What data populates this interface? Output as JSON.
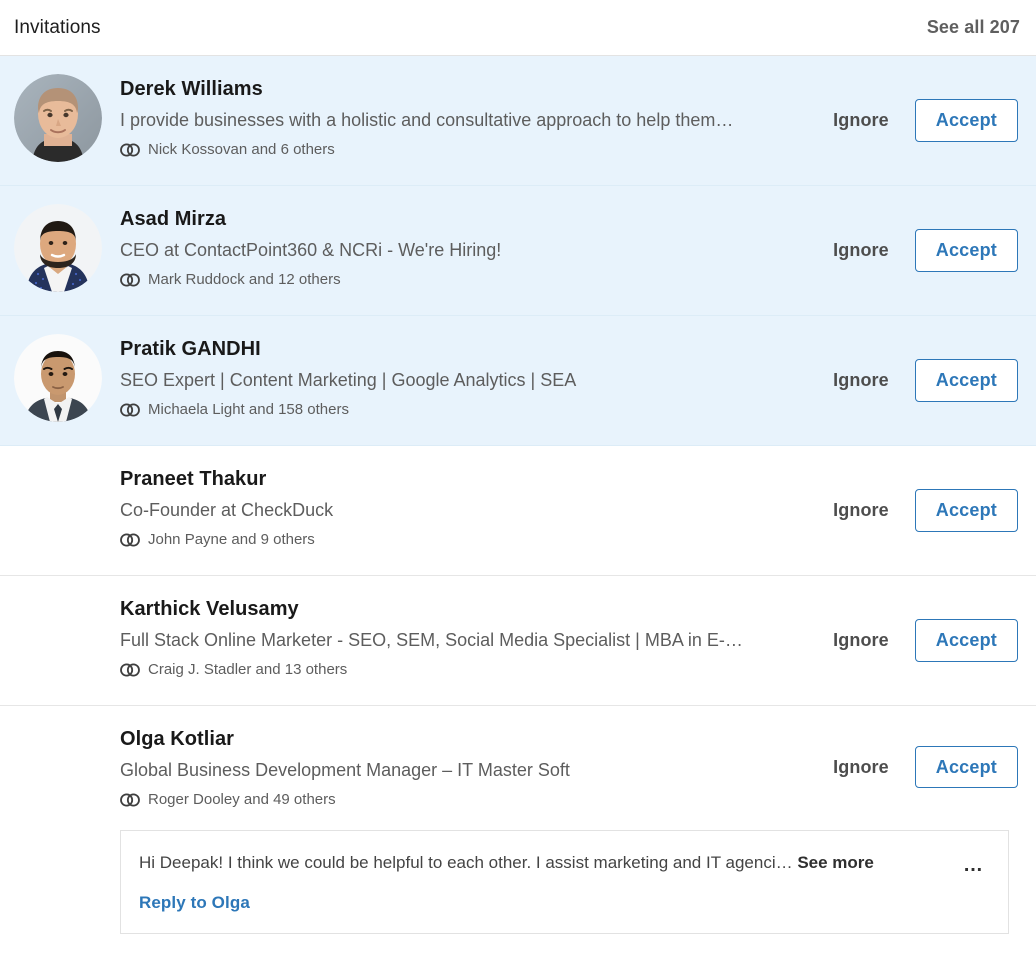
{
  "header": {
    "title": "Invitations",
    "see_all_label": "See all 207",
    "see_all_count": 207
  },
  "actions": {
    "ignore_label": "Ignore",
    "accept_label": "Accept"
  },
  "colors": {
    "accent": "#2d77b8",
    "unread_row_background": "#e8f3fc",
    "row_background": "#ffffff",
    "primary_text": "#191919",
    "secondary_text": "#5d5d5d",
    "divider": "#e6e6e6"
  },
  "icons": {
    "mutual_connections": "mutual-connections-icon",
    "overflow": "overflow-menu-icon"
  },
  "invitations": [
    {
      "name": "Derek Williams",
      "headline": "I provide businesses with a holistic and consultative approach to help them…",
      "mutual": "Nick Kossovan and 6 others",
      "unread": true,
      "has_avatar": true,
      "avatar_alt": "Derek Williams profile photo"
    },
    {
      "name": "Asad Mirza",
      "headline": "CEO at ContactPoint360 & NCRi - We're Hiring!",
      "mutual": "Mark Ruddock and 12 others",
      "unread": true,
      "has_avatar": true,
      "avatar_alt": "Asad Mirza profile photo"
    },
    {
      "name": "Pratik GANDHI",
      "headline": "SEO Expert | Content Marketing | Google Analytics | SEA",
      "mutual": "Michaela Light and 158 others",
      "unread": true,
      "has_avatar": true,
      "avatar_alt": "Pratik GANDHI profile photo"
    },
    {
      "name": "Praneet Thakur",
      "headline": "Co-Founder at CheckDuck",
      "mutual": "John Payne and 9 others",
      "unread": false,
      "has_avatar": false,
      "avatar_alt": ""
    },
    {
      "name": "Karthick Velusamy",
      "headline": "Full Stack Online Marketer - SEO, SEM, Social Media Specialist | MBA in E-…",
      "mutual": "Craig J. Stadler and 13 others",
      "unread": false,
      "has_avatar": false,
      "avatar_alt": ""
    },
    {
      "name": "Olga Kotliar",
      "headline": "Global Business Development Manager – IT Master Soft",
      "mutual": "Roger Dooley and 49 others",
      "unread": false,
      "has_avatar": false,
      "avatar_alt": "",
      "message": {
        "text": "Hi Deepak! I think we could be helpful to each other. I assist marketing and IT agenci… ",
        "see_more_label": "See more",
        "reply_label": "Reply to Olga",
        "overflow_label": "…"
      }
    }
  ]
}
